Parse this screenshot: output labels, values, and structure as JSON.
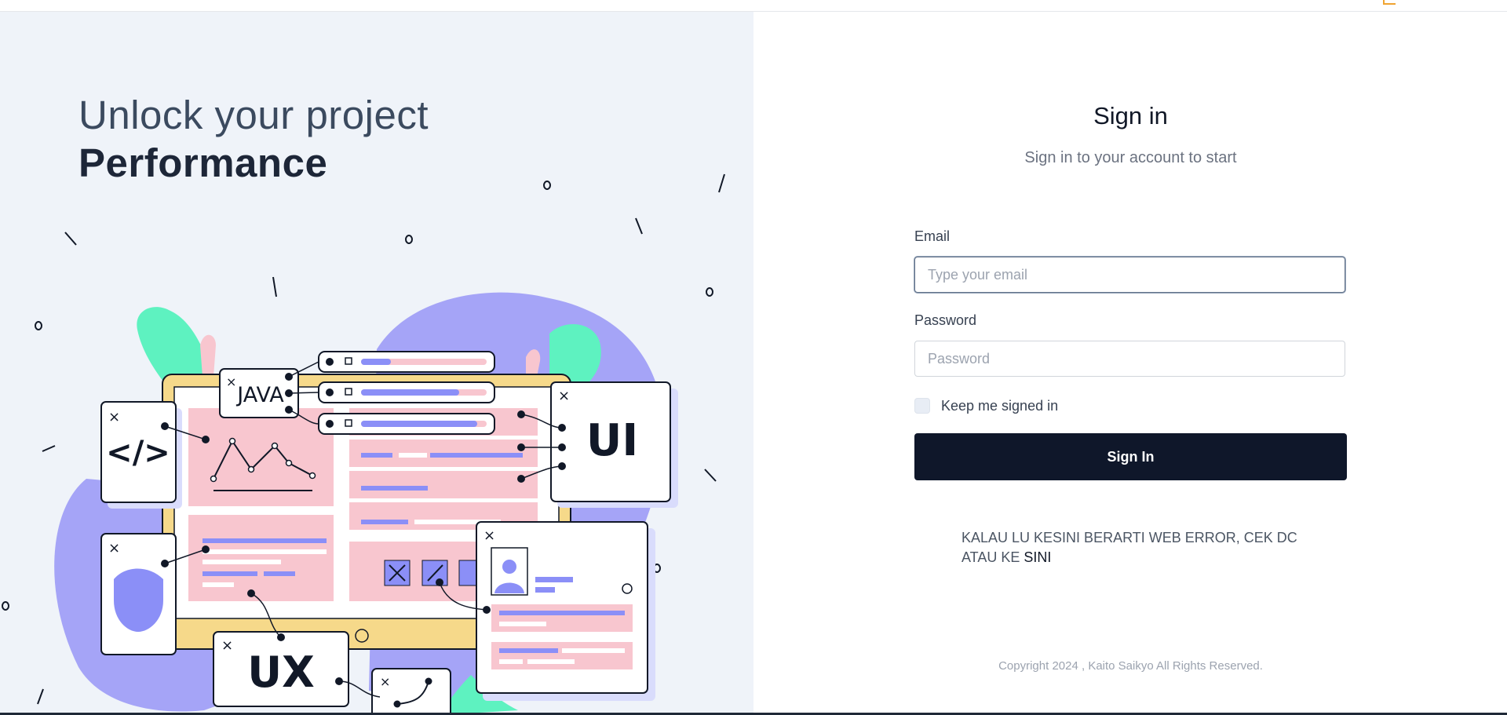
{
  "hero": {
    "line1": "Unlock your project",
    "line2": "Performance"
  },
  "illustration": {
    "code_card": "</>",
    "java_card": "JAVA",
    "ui_card": "UI",
    "ux_card": "UX",
    "close_glyph": "×",
    "colors": {
      "purple": "#a5a4f7",
      "mint": "#5ef2c0",
      "pink": "#f8c6cf",
      "yellow": "#f6d98a",
      "navy": "#111827"
    }
  },
  "form": {
    "title": "Sign in",
    "subtitle": "Sign in to your account to start",
    "email_label": "Email",
    "email_placeholder": "Type your email",
    "password_label": "Password",
    "password_placeholder": "Password",
    "keep_signed_in": "Keep me signed in",
    "submit": "Sign In"
  },
  "notice": {
    "text": "KALAU LU KESINI BERARTI WEB ERROR, CEK DC ATAU KE ",
    "link": "SINI"
  },
  "footer": {
    "copyright": "Copyright 2024 , Kaito Saikyo All Rights Reserved."
  }
}
